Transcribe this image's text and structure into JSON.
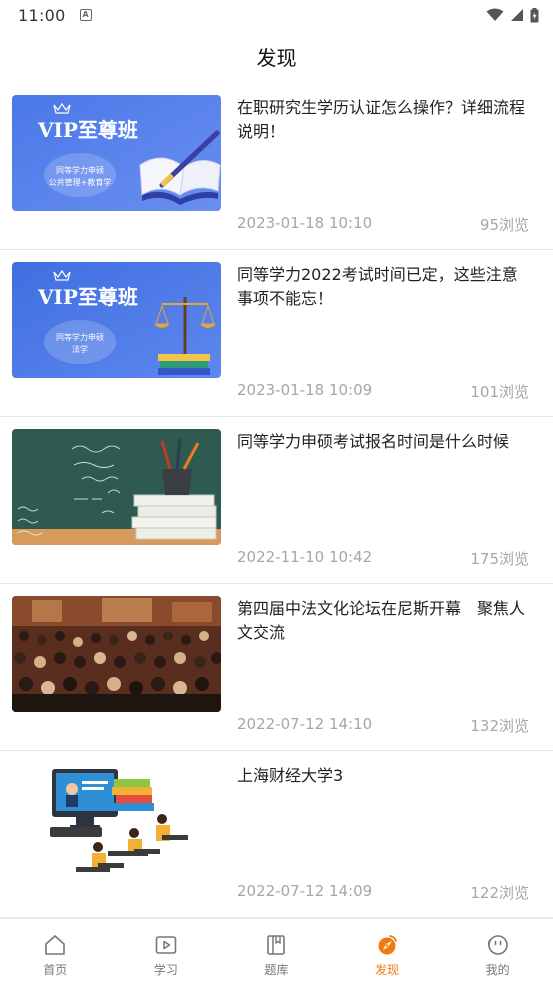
{
  "status_bar": {
    "time": "11:00",
    "a_icon": "A"
  },
  "header": {
    "title": "发现"
  },
  "articles": [
    {
      "title": "在职研究生学历认证怎么操作？详细流程说明！",
      "date": "2023-01-18 10:10",
      "views": "95浏览",
      "thumb": {
        "kind": "vip-book",
        "heading": "VIP至尊班",
        "line1": "同等学力申硕",
        "line2": "公共管理+教育学"
      }
    },
    {
      "title": "同等学力2022考试时间已定，这些注意事项不能忘！",
      "date": "2023-01-18 10:09",
      "views": "101浏览",
      "thumb": {
        "kind": "vip-scale",
        "heading": "VIP至尊班",
        "line1": "同等学力申硕",
        "line2": "法学"
      }
    },
    {
      "title": "同等学力申硕考试报名时间是什么时候",
      "date": "2022-11-10 10:42",
      "views": "175浏览",
      "thumb": {
        "kind": "blackboard"
      }
    },
    {
      "title": "第四届中法文化论坛在尼斯开幕　聚焦人文交流",
      "date": "2022-07-12 14:10",
      "views": "132浏览",
      "thumb": {
        "kind": "auditorium"
      }
    },
    {
      "title": "上海财经大学3",
      "date": "2022-07-12 14:09",
      "views": "122浏览",
      "thumb": {
        "kind": "online-class"
      }
    }
  ],
  "tabbar": [
    {
      "label": "首页",
      "icon": "home-icon",
      "active": false
    },
    {
      "label": "学习",
      "icon": "play-icon",
      "active": false
    },
    {
      "label": "题库",
      "icon": "book-icon",
      "active": false
    },
    {
      "label": "发现",
      "icon": "compass-icon",
      "active": true
    },
    {
      "label": "我的",
      "icon": "face-icon",
      "active": false
    }
  ],
  "colors": {
    "accent": "#f07a12",
    "muted": "#a6a6a6",
    "vip_blue": "#4a74e0"
  }
}
